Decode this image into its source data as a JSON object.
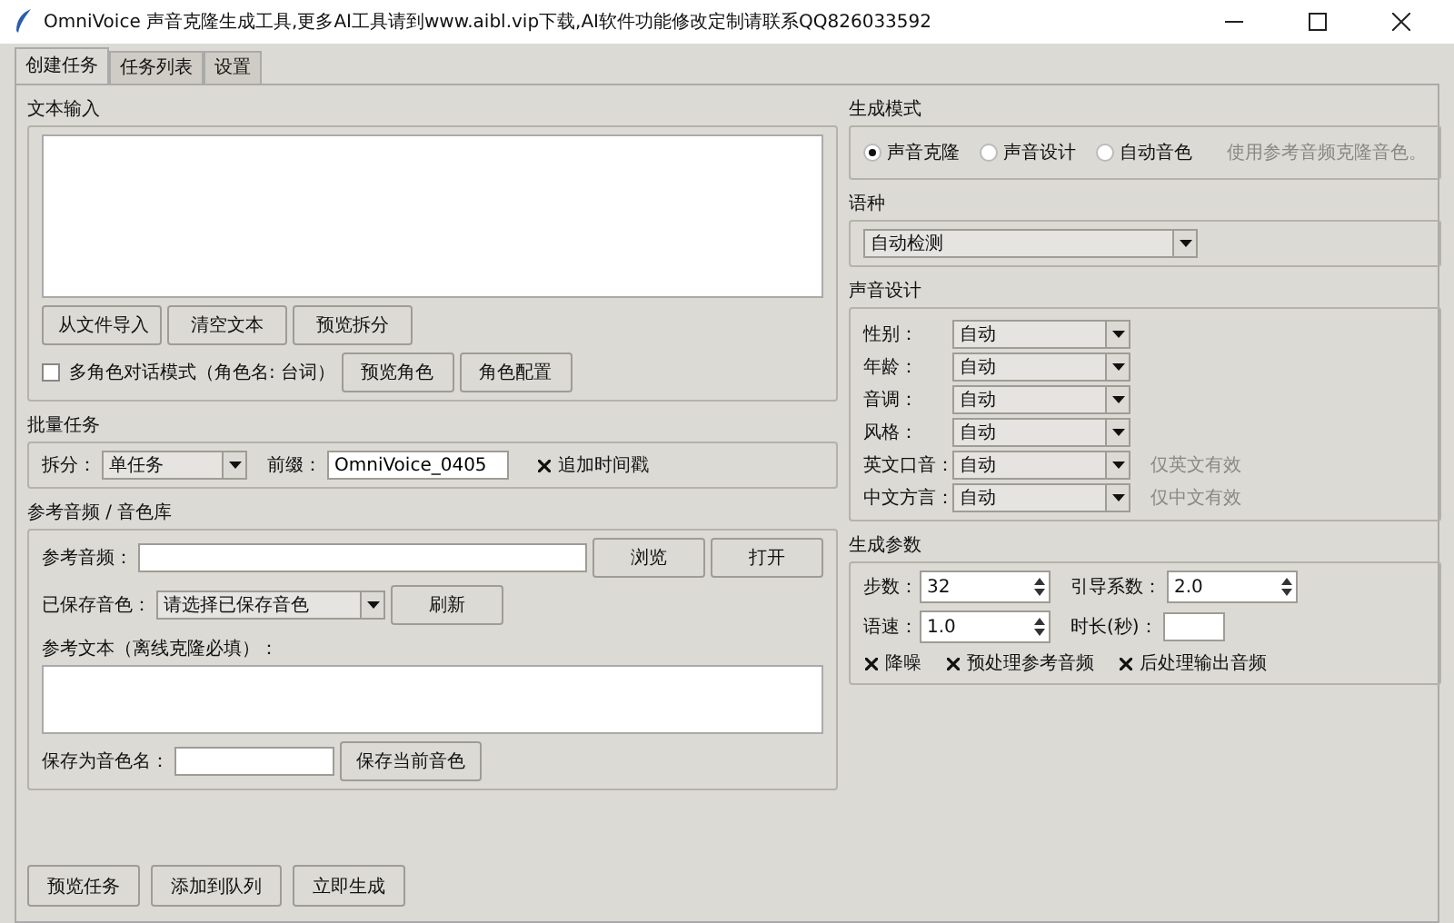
{
  "window": {
    "title": "OmniVoice 声音克隆生成工具,更多AI工具请到www.aibl.vip下载,AI软件功能修改定制请联系QQ826033592"
  },
  "tabs": [
    {
      "label": "创建任务",
      "selected": true
    },
    {
      "label": "任务列表",
      "selected": false
    },
    {
      "label": "设置",
      "selected": false
    }
  ],
  "text_input": {
    "title": "文本输入",
    "buttons": [
      "从文件导入",
      "清空文本",
      "预览拆分"
    ],
    "multi_role": {
      "label": "多角色对话模式（角色名: 台词）",
      "checked": false
    },
    "role_buttons": [
      "预览角色",
      "角色配置"
    ]
  },
  "batch": {
    "title": "批量任务",
    "split_label": "拆分：",
    "split_value": "单任务",
    "prefix_label": "前缀：",
    "prefix_value": "OmniVoice_0405",
    "timestamp": {
      "label": "追加时间戳",
      "checked": true
    }
  },
  "reference": {
    "title": "参考音频 / 音色库",
    "audio_label": "参考音频：",
    "browse_button": "浏览",
    "open_button": "打开",
    "saved_label": "已保存音色：",
    "saved_value": "请选择已保存音色",
    "refresh_button": "刷新",
    "ref_text_label": "参考文本（离线克隆必填）：",
    "save_name_label": "保存为音色名：",
    "save_button": "保存当前音色"
  },
  "mode": {
    "title": "生成模式",
    "options": [
      {
        "label": "声音克隆",
        "selected": true
      },
      {
        "label": "声音设计",
        "selected": false
      },
      {
        "label": "自动音色",
        "selected": false
      }
    ],
    "hint": "使用参考音频克隆音色。"
  },
  "language": {
    "title": "语种",
    "value": "自动检测"
  },
  "design": {
    "title": "声音设计",
    "rows": [
      {
        "label": "性别：",
        "value": "自动"
      },
      {
        "label": "年龄：",
        "value": "自动"
      },
      {
        "label": "音调：",
        "value": "自动"
      },
      {
        "label": "风格：",
        "value": "自动"
      },
      {
        "label": "英文口音：",
        "value": "自动",
        "note": "仅英文有效"
      },
      {
        "label": "中文方言：",
        "value": "自动",
        "note": "仅中文有效"
      }
    ]
  },
  "params": {
    "title": "生成参数",
    "steps": {
      "label": "步数：",
      "value": "32"
    },
    "guidance": {
      "label": "引导系数：",
      "value": "2.0"
    },
    "speed": {
      "label": "语速：",
      "value": "1.0"
    },
    "duration": {
      "label": "时长(秒)："
    },
    "checks": [
      {
        "label": "降噪",
        "checked": true
      },
      {
        "label": "预处理参考音频",
        "checked": true
      },
      {
        "label": "后处理输出音频",
        "checked": true
      }
    ]
  },
  "actions": [
    "预览任务",
    "添加到队列",
    "立即生成"
  ]
}
